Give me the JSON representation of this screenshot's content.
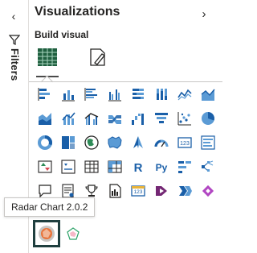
{
  "filters": {
    "label": "Filters",
    "toggle_icon": "chevron-left-icon"
  },
  "visualizations": {
    "title": "Visualizations",
    "collapse_icon": "chevron-right-icon",
    "build_label": "Build visual",
    "modes": [
      {
        "name": "build-visual-mode",
        "icon": "table-grid-icon",
        "active": true
      },
      {
        "name": "format-visual-mode",
        "icon": "paintbrush-page-icon",
        "active": false
      }
    ],
    "gallery": [
      {
        "name": "stacked-bar-chart-icon",
        "type": "hbars"
      },
      {
        "name": "stacked-column-chart-icon",
        "type": "vbars"
      },
      {
        "name": "clustered-bar-chart-icon",
        "type": "hbars2"
      },
      {
        "name": "clustered-column-chart-icon",
        "type": "vbars2"
      },
      {
        "name": "100-stacked-bar-chart-icon",
        "type": "hbars3"
      },
      {
        "name": "100-stacked-column-chart-icon",
        "type": "vbars3"
      },
      {
        "name": "line-chart-icon",
        "type": "line"
      },
      {
        "name": "area-chart-icon",
        "type": "area"
      },
      {
        "name": "stacked-area-chart-icon",
        "type": "area2"
      },
      {
        "name": "line-stacked-column-chart-icon",
        "type": "combo"
      },
      {
        "name": "line-clustered-column-chart-icon",
        "type": "combo2"
      },
      {
        "name": "ribbon-chart-icon",
        "type": "ribbon"
      },
      {
        "name": "waterfall-chart-icon",
        "type": "waterfall"
      },
      {
        "name": "funnel-chart-icon",
        "type": "funnel"
      },
      {
        "name": "scatter-chart-icon",
        "type": "scatter"
      },
      {
        "name": "pie-chart-icon",
        "type": "pie"
      },
      {
        "name": "donut-chart-icon",
        "type": "donut"
      },
      {
        "name": "treemap-icon",
        "type": "treemap"
      },
      {
        "name": "map-icon",
        "type": "globe"
      },
      {
        "name": "filled-map-icon",
        "type": "filledmap"
      },
      {
        "name": "azure-map-icon",
        "type": "azure"
      },
      {
        "name": "gauge-icon",
        "type": "gauge"
      },
      {
        "name": "card-icon",
        "type": "card"
      },
      {
        "name": "multi-row-card-icon",
        "type": "multirow"
      },
      {
        "name": "kpi-icon",
        "type": "kpi"
      },
      {
        "name": "slicer-icon",
        "type": "slicer"
      },
      {
        "name": "table-icon",
        "type": "table"
      },
      {
        "name": "matrix-icon",
        "type": "matrix"
      },
      {
        "name": "r-script-visual-icon",
        "type": "r"
      },
      {
        "name": "python-visual-icon",
        "type": "py"
      },
      {
        "name": "key-influencers-icon",
        "type": "keyinf"
      },
      {
        "name": "decomposition-tree-icon",
        "type": "decomp"
      },
      {
        "name": "qa-icon",
        "type": "qa"
      },
      {
        "name": "smart-narrative-icon",
        "type": "narrative"
      },
      {
        "name": "goals-icon",
        "type": "trophy"
      },
      {
        "name": "paginated-report-icon",
        "type": "paginated"
      },
      {
        "name": "new-card-icon",
        "type": "newcard"
      },
      {
        "name": "power-apps-icon",
        "type": "powerapps"
      },
      {
        "name": "power-automate-icon",
        "type": "automate"
      },
      {
        "name": "more-visuals-icon",
        "type": "diamond"
      }
    ],
    "tooltip": "Radar Chart 2.0.2",
    "custom_visuals": [
      {
        "name": "radar-chart-visual-icon",
        "selected": true
      },
      {
        "name": "custom-visual-icon",
        "selected": false
      }
    ]
  },
  "colors": {
    "accent_teal": "#118dff",
    "icon_dark": "#252423",
    "icon_blue": "#1a5fa8",
    "icon_light_blue": "#5b9bd5",
    "selected_border": "#1f3f3f"
  }
}
